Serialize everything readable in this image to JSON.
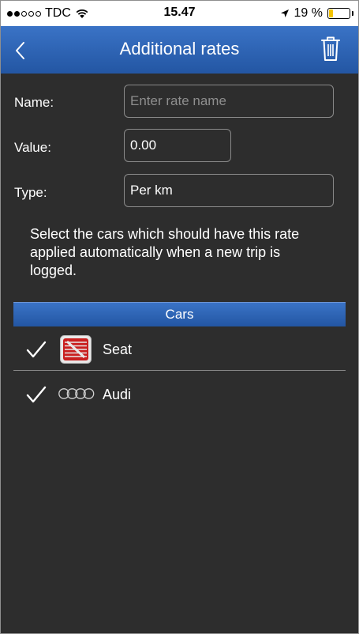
{
  "status_bar": {
    "carrier": "TDC",
    "time": "15.47",
    "battery": "19 %",
    "battery_level": 0.19,
    "battery_color": "#f5c400"
  },
  "nav": {
    "title": "Additional rates",
    "back_icon": "chevron-left-icon",
    "delete_icon": "trash-icon"
  },
  "form": {
    "name_label": "Name:",
    "name_value": "",
    "name_placeholder": "Enter rate name",
    "value_label": "Value:",
    "value_value": "0.00",
    "type_label": "Type:",
    "type_value": "Per km"
  },
  "info_text": "Select the cars which should have this rate applied automatically when a new trip is logged.",
  "cars_section": {
    "header": "Cars",
    "items": [
      {
        "name": "Seat",
        "checked": true,
        "logo": "seat-logo"
      },
      {
        "name": "Audi",
        "checked": true,
        "logo": "audi-logo"
      }
    ]
  },
  "colors": {
    "accent": "#2d62b2",
    "background": "#2d2d2d",
    "text": "#ffffff"
  }
}
